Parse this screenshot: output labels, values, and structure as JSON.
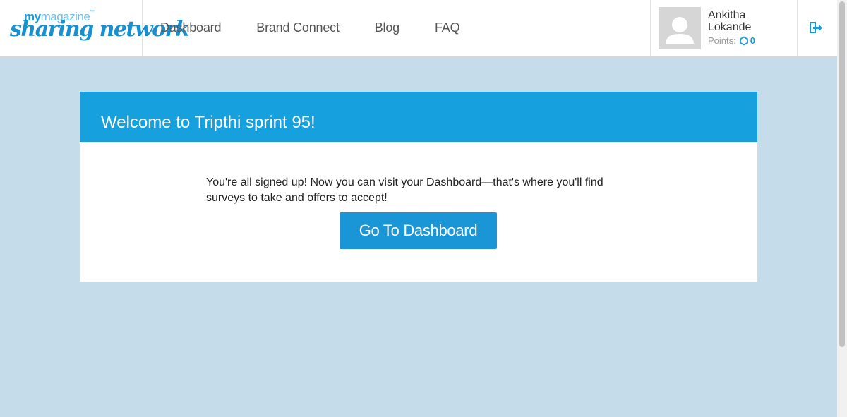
{
  "logo": {
    "line1_my": "my",
    "line1_mag": "magazine",
    "line1_tm": "™",
    "line2": "sharing network"
  },
  "nav": {
    "items": [
      "Dashboard",
      "Brand Connect",
      "Blog",
      "FAQ"
    ]
  },
  "user": {
    "name": "Ankitha Lokande",
    "points_label": "Points:",
    "points_value": "0"
  },
  "icons": {
    "avatar": "user-silhouette-icon",
    "points": "hexagon-icon",
    "logout": "logout-icon"
  },
  "card": {
    "title": "Welcome to Tripthi sprint 95!",
    "message": "You're all signed up! Now you can visit your Dashboard—that's where you'll find surveys to take and offers to accept!",
    "button_label": "Go To Dashboard"
  },
  "colors": {
    "accent": "#16a1de",
    "background": "#c5dcea",
    "button": "#1a96d6"
  }
}
